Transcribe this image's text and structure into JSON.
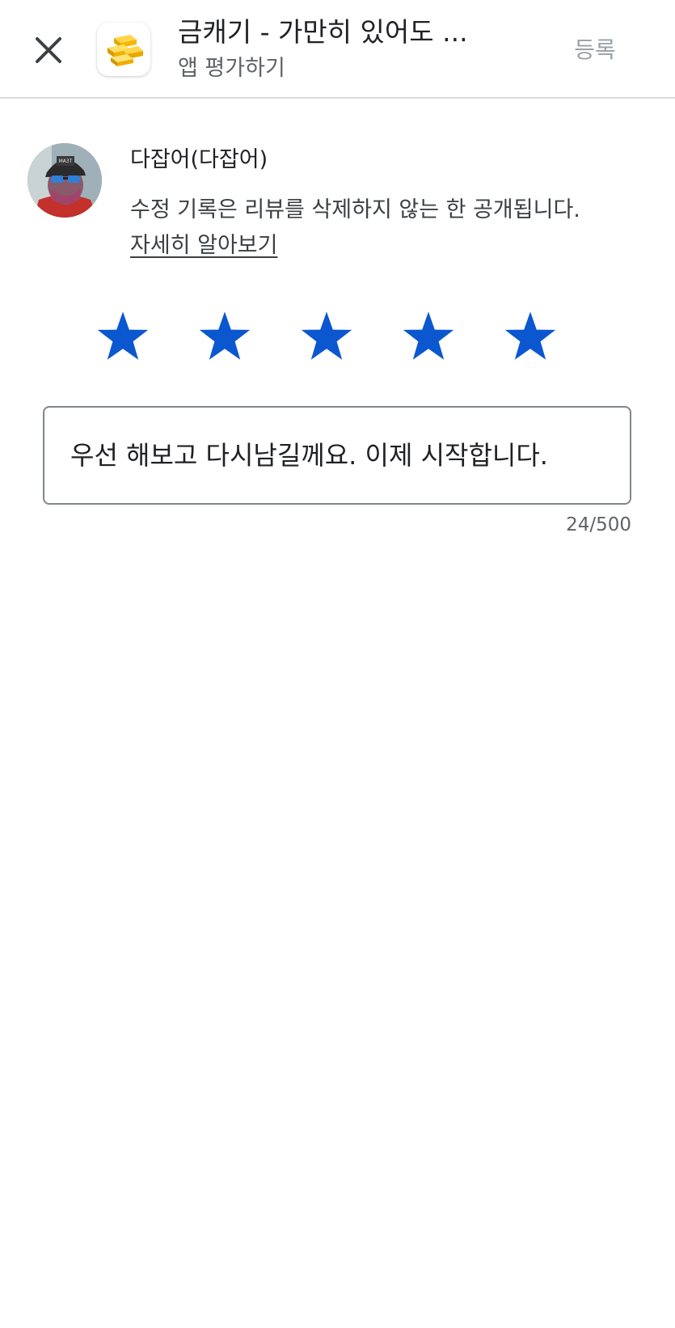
{
  "header": {
    "app_title": "금캐기 - 가만히 있어도 ...",
    "subtitle": "앱 평가하기",
    "submit_label": "등록",
    "close_icon": "close-icon",
    "app_icon": "gold-bars-icon"
  },
  "user": {
    "name": "다잡어(다잡어)",
    "notice": "수정 기록은 리뷰를 삭제하지 않는 한 공개됩니다.",
    "learn_more": "자세히 알아보기"
  },
  "rating": {
    "value": 5,
    "max": 5,
    "star_color": "#0b57d0"
  },
  "review": {
    "text": "우선 해보고 다시남길께요. 이제 시작합니다.",
    "char_count": "24/500"
  }
}
